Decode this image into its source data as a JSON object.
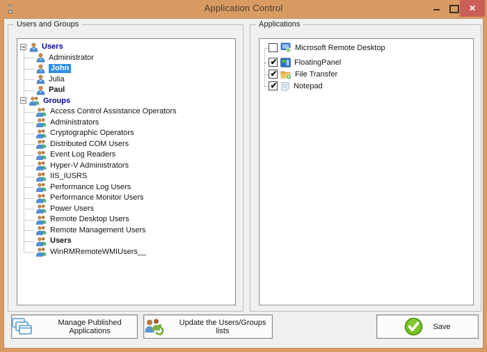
{
  "window": {
    "title": "Application Control",
    "controls": {
      "minimize": "minimize",
      "maximize": "maximize",
      "close": "✕"
    },
    "colors": {
      "titlebar": "#DA9B62",
      "close_button": "#C95F58",
      "selection": "#2E8DE5",
      "parent_node_text": "#00009B",
      "client_bg": "#f0f0f0"
    }
  },
  "left_panel": {
    "title": "Users and Groups",
    "tree": [
      {
        "label": "Users",
        "level": 0,
        "icon": "user",
        "bold": true,
        "navy": true,
        "expander": true
      },
      {
        "label": "Administrator",
        "level": 1,
        "icon": "user"
      },
      {
        "label": "John",
        "level": 1,
        "icon": "user",
        "selected": true
      },
      {
        "label": "Julia",
        "level": 1,
        "icon": "user"
      },
      {
        "label": "Paul",
        "level": 1,
        "icon": "user",
        "bold": true
      },
      {
        "label": "Groups",
        "level": 0,
        "icon": "group",
        "bold": true,
        "navy": true,
        "expander": true
      },
      {
        "label": "Access Control Assistance Operators",
        "level": 1,
        "icon": "group"
      },
      {
        "label": "Administrators",
        "level": 1,
        "icon": "group"
      },
      {
        "label": "Cryptographic Operators",
        "level": 1,
        "icon": "group"
      },
      {
        "label": "Distributed COM Users",
        "level": 1,
        "icon": "group"
      },
      {
        "label": "Event Log Readers",
        "level": 1,
        "icon": "group"
      },
      {
        "label": "Hyper-V Administrators",
        "level": 1,
        "icon": "group"
      },
      {
        "label": "IIS_IUSRS",
        "level": 1,
        "icon": "group"
      },
      {
        "label": "Performance Log Users",
        "level": 1,
        "icon": "group"
      },
      {
        "label": "Performance Monitor Users",
        "level": 1,
        "icon": "group"
      },
      {
        "label": "Power Users",
        "level": 1,
        "icon": "group"
      },
      {
        "label": "Remote Desktop Users",
        "level": 1,
        "icon": "group"
      },
      {
        "label": "Remote Management Users",
        "level": 1,
        "icon": "group"
      },
      {
        "label": "Users",
        "level": 1,
        "icon": "group",
        "bold": true
      },
      {
        "label": "WinRMRemoteWMIUsers__",
        "level": 1,
        "icon": "group"
      }
    ]
  },
  "right_panel": {
    "title": "Applications",
    "items": [
      {
        "label": "Microsoft Remote Desktop",
        "checked": false,
        "icon": "remote-desktop"
      },
      {
        "label": "FloatingPanel",
        "checked": true,
        "icon": "floating-panel"
      },
      {
        "label": "File Transfer",
        "checked": true,
        "icon": "file-transfer"
      },
      {
        "label": "Notepad",
        "checked": true,
        "icon": "notepad"
      }
    ],
    "checkmark": "✔"
  },
  "buttons": {
    "manage": {
      "label": "Manage Published Applications",
      "icon": "cascading-windows"
    },
    "update": {
      "label": "Update the Users/Groups lists",
      "icon": "refresh-users"
    },
    "save": {
      "label": "Save",
      "icon": "green-check"
    }
  }
}
